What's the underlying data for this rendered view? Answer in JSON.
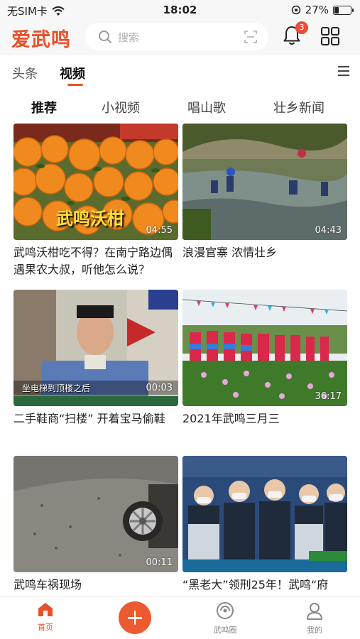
{
  "status_bar": {
    "carrier": "无SIM卡",
    "time": "18:02",
    "battery": "27%",
    "battery_level": 0.27
  },
  "header": {
    "logo": "爱武鸣",
    "search_placeholder": "搜索",
    "notification_count": "3",
    "accent_color": "#e8502a"
  },
  "channels": {
    "tabs": [
      {
        "label": "头条"
      },
      {
        "label": "视频"
      }
    ],
    "active": "视频"
  },
  "subtabs": {
    "tabs": [
      {
        "label": "推荐"
      },
      {
        "label": "小视频"
      },
      {
        "label": "唱山歌"
      },
      {
        "label": "壮乡新闻"
      }
    ],
    "active": "推荐"
  },
  "videos": [
    {
      "title": "武鸣沃柑吃不得？在南宁路边偶遇果农大叔，听他怎么说？",
      "duration": "04:55",
      "overlay_text": "武鸣沃柑"
    },
    {
      "title": "浪漫官寨 浓情壮乡",
      "duration": "04:43"
    },
    {
      "title": "二手鞋商“扫楼” 开着宝马偷鞋",
      "duration": "00:03",
      "overlay_text": "坐电梯到顶楼之后"
    },
    {
      "title": "2021年武鸣三月三",
      "duration": "36:17"
    },
    {
      "title": "武鸣车祸现场",
      "duration": "00:11"
    },
    {
      "title": "“黑老大”领刑25年！武鸣“府",
      "duration": ""
    }
  ],
  "bottom_nav": {
    "items": [
      {
        "label": "首页"
      },
      {
        "label": "武鸣圈"
      },
      {
        "label": "我的"
      }
    ],
    "active": "首页"
  }
}
